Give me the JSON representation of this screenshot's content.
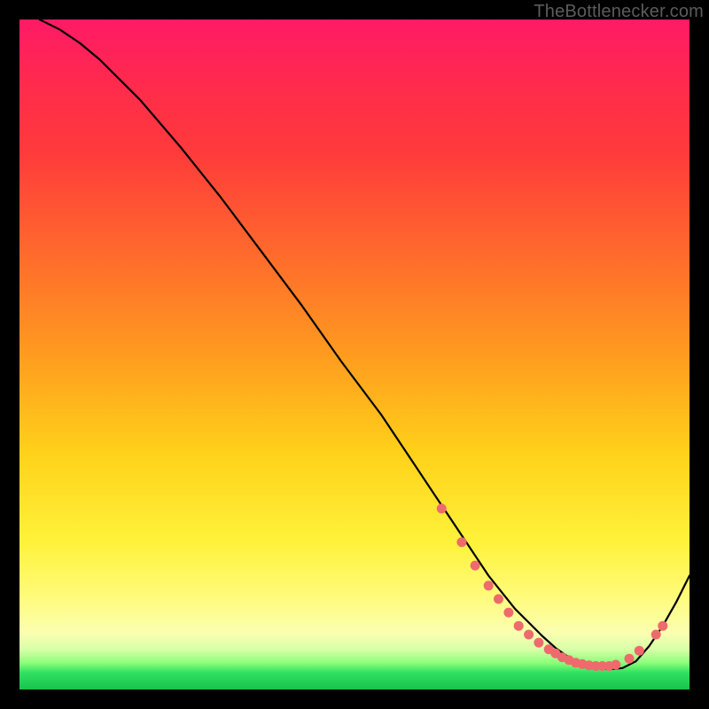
{
  "watermark": "TheBottlenecker.com",
  "chart_data": {
    "type": "line",
    "title": "",
    "xlabel": "",
    "ylabel": "",
    "xlim": [
      0,
      100
    ],
    "ylim": [
      0,
      100
    ],
    "grid": false,
    "legend": false,
    "background": "rainbow-vertical-gradient",
    "curve": {
      "stroke": "#000000",
      "width": 2.2,
      "x": [
        3,
        6,
        9,
        12,
        18,
        24,
        30,
        36,
        42,
        48,
        54,
        58,
        62,
        66,
        68,
        70,
        72,
        74,
        76,
        78,
        80,
        82,
        84,
        86,
        88,
        90,
        92,
        94,
        96,
        98,
        100
      ],
      "y": [
        100,
        98.5,
        96.5,
        94,
        88,
        81,
        73.5,
        65.5,
        57.5,
        49,
        41,
        35,
        29,
        23,
        20,
        17,
        14.5,
        12,
        10,
        8,
        6.2,
        4.8,
        3.8,
        3.2,
        3,
        3.2,
        4.2,
        6.5,
        9.5,
        13,
        17
      ]
    },
    "markers": {
      "fill": "#ef6a6d",
      "stroke": "#ef6a6d",
      "r": 5,
      "points": [
        {
          "x": 63,
          "y": 27
        },
        {
          "x": 66,
          "y": 22
        },
        {
          "x": 68,
          "y": 18.5
        },
        {
          "x": 70,
          "y": 15.5
        },
        {
          "x": 71.5,
          "y": 13.5
        },
        {
          "x": 73,
          "y": 11.5
        },
        {
          "x": 74.5,
          "y": 9.5
        },
        {
          "x": 76,
          "y": 8.2
        },
        {
          "x": 77.5,
          "y": 7.0
        },
        {
          "x": 79,
          "y": 6.0
        },
        {
          "x": 80,
          "y": 5.4
        },
        {
          "x": 81,
          "y": 4.8
        },
        {
          "x": 82,
          "y": 4.4
        },
        {
          "x": 83,
          "y": 4.0
        },
        {
          "x": 84,
          "y": 3.8
        },
        {
          "x": 85,
          "y": 3.6
        },
        {
          "x": 86,
          "y": 3.5
        },
        {
          "x": 87,
          "y": 3.5
        },
        {
          "x": 88,
          "y": 3.5
        },
        {
          "x": 89,
          "y": 3.7
        },
        {
          "x": 91,
          "y": 4.6
        },
        {
          "x": 92.5,
          "y": 5.8
        },
        {
          "x": 95,
          "y": 8.2
        },
        {
          "x": 96,
          "y": 9.5
        }
      ]
    }
  }
}
